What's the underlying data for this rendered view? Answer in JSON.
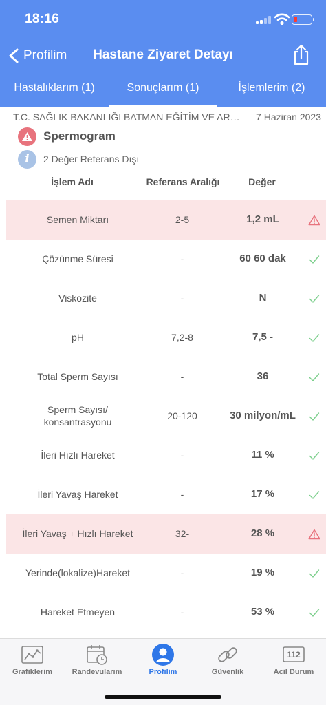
{
  "status_bar": {
    "time": "18:16"
  },
  "nav": {
    "back_label": "Profilim",
    "title": "Hastane Ziyaret Detayı"
  },
  "tabs": [
    {
      "label": "Hastalıklarım (1)",
      "active": false
    },
    {
      "label": "Sonuçlarım (1)",
      "active": true
    },
    {
      "label": "İşlemlerim (2)",
      "active": false
    }
  ],
  "visit": {
    "hospital": "T.C. SAĞLIK BAKANLIĞI BATMAN EĞİTİM VE ARAŞTIRMA HASTANESİ",
    "date": "7 Haziran 2023"
  },
  "test": {
    "name": "Spermogram",
    "info": "2 Değer Referans Dışı"
  },
  "table": {
    "headers": {
      "name": "İşlem Adı",
      "reference": "Referans Aralığı",
      "value": "Değer"
    },
    "rows": [
      {
        "name": "Semen Miktarı",
        "reference": "2-5",
        "value": "1,2 mL",
        "status": "warning-icon"
      },
      {
        "name": "Çözünme Süresi",
        "reference": "-",
        "value": "60 60 dak",
        "status": "check-icon"
      },
      {
        "name": "Viskozite",
        "reference": "-",
        "value": "N",
        "status": "check-icon"
      },
      {
        "name": "pH",
        "reference": "7,2-8",
        "value": "7,5 -",
        "status": "check-icon"
      },
      {
        "name": "Total Sperm Sayısı",
        "reference": "-",
        "value": "36",
        "status": "check-icon"
      },
      {
        "name": "Sperm Sayısı/\nkonsantrasyonu",
        "reference": "20-120",
        "value": "30 milyon/mL",
        "status": "check-icon"
      },
      {
        "name": "İleri Hızlı Hareket",
        "reference": "-",
        "value": "11 %",
        "status": "check-icon"
      },
      {
        "name": "İleri Yavaş Hareket",
        "reference": "-",
        "value": "17 %",
        "status": "check-icon"
      },
      {
        "name": "İleri Yavaş + Hızlı Hareket",
        "reference": "32-",
        "value": "28 %",
        "status": "warning-icon"
      },
      {
        "name": "Yerinde(lokalize)Hareket",
        "reference": "-",
        "value": "19 %",
        "status": "check-icon"
      },
      {
        "name": "Hareket Etmeyen",
        "reference": "-",
        "value": "53 %",
        "status": "check-icon"
      }
    ]
  },
  "tabbar": [
    {
      "label": "Grafiklerim",
      "icon": "chart-icon",
      "active": false
    },
    {
      "label": "Randevularım",
      "icon": "calendar-clock-icon",
      "active": false
    },
    {
      "label": "Profilim",
      "icon": "person-icon",
      "active": true
    },
    {
      "label": "Güvenlik",
      "icon": "chain-link-icon",
      "active": false
    },
    {
      "label": "Acil Durum",
      "icon": "emergency-112-icon",
      "active": false,
      "badge": "112"
    }
  ],
  "colors": {
    "header": "#5a8df0",
    "flagged_row": "#fbe5e6",
    "warning": "#e8737d",
    "check": "#7ccf8c",
    "active_tab": "#2f77e8"
  }
}
